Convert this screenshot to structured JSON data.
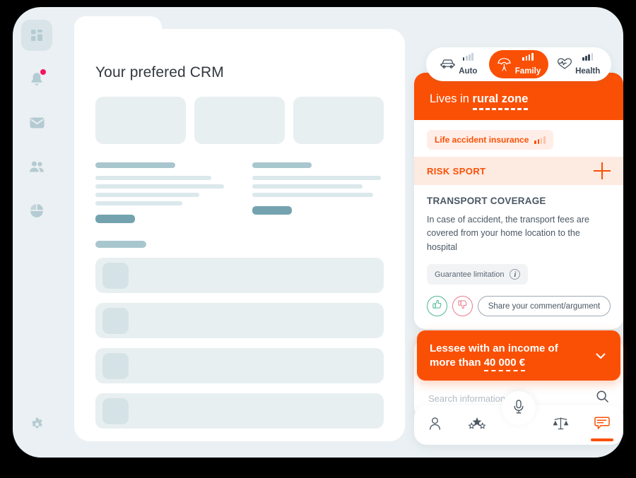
{
  "sidebar": {
    "items": [
      {
        "name": "dashboard",
        "icon": "grid-icon",
        "active": true,
        "badge": false
      },
      {
        "name": "notifications",
        "icon": "bell-icon",
        "active": false,
        "badge": true
      },
      {
        "name": "messages",
        "icon": "envelope-icon",
        "active": false,
        "badge": false
      },
      {
        "name": "contacts",
        "icon": "people-icon",
        "active": false,
        "badge": false
      },
      {
        "name": "analytics",
        "icon": "pie-chart-icon",
        "active": false,
        "badge": false
      }
    ],
    "bottom_item": {
      "name": "settings",
      "icon": "gear-icon"
    }
  },
  "crm": {
    "title": "Your prefered CRM",
    "tiles": [
      1,
      2,
      3
    ],
    "skeleton_columns": [
      {
        "head_width": "61%",
        "lines": [
          "88%",
          "98%",
          "79%",
          "66%"
        ],
        "chip": "small-dark"
      },
      {
        "head_width": "45%",
        "lines": [
          "98%",
          "84%",
          "92%"
        ],
        "chip": "small-dark"
      }
    ],
    "list_rows": [
      1,
      2,
      3,
      4
    ]
  },
  "tabs": [
    {
      "label": "Auto",
      "icon": "car-icon",
      "selected": false,
      "signal_level": 1
    },
    {
      "label": "Family",
      "icon": "umbrella-family-icon",
      "selected": true,
      "signal_level": 4
    },
    {
      "label": "Health",
      "icon": "heart-pulse-icon",
      "selected": false,
      "selected_alt": false,
      "signal_level": 3
    }
  ],
  "banner": {
    "prefix": "Lives in ",
    "highlight": "rural zone"
  },
  "insurance_chip": {
    "label": "Life accident insurance",
    "signal_level": 2
  },
  "risk_section": {
    "label": "RISK SPORT",
    "expand_icon": "plus-icon"
  },
  "coverage": {
    "title": "TRANSPORT COVERAGE",
    "description": "In case of accident, the transport fees are covered from your home location to the hospital",
    "guarantee_chip": {
      "label": "Guarantee limitation",
      "icon": "info-icon",
      "icon_glyph": "i"
    },
    "feedback": {
      "thumbs_up": "thumbs-up-icon",
      "thumbs_down": "thumbs-down-icon",
      "comment_label": "Share your comment/argument"
    }
  },
  "lessee": {
    "line1": "Lessee with an income of",
    "line2_prefix": "more than ",
    "amount": "40 000 €",
    "chevron": "chevron-down-icon"
  },
  "search": {
    "placeholder": "Search information...",
    "value": "",
    "icon": "search-icon"
  },
  "bottom_nav": {
    "items": [
      {
        "name": "profile",
        "icon": "person-icon",
        "active": false
      },
      {
        "name": "favorites",
        "icon": "stars-icon",
        "active": false
      },
      {
        "name": "mic",
        "icon": "microphone-icon",
        "active": false
      },
      {
        "name": "compare",
        "icon": "scales-icon",
        "active": false
      },
      {
        "name": "chat",
        "icon": "chat-bubble-icon",
        "active": true
      }
    ]
  },
  "colors": {
    "accent_orange": "#fa5005",
    "accent_orange_soft": "#fdeae1",
    "accent_orange_chip": "#ffeee7",
    "panel_bg": "#eaf0f3",
    "skeleton_light": "#dbe8ec",
    "skeleton_mid": "#a8c6cd",
    "skeleton_dark": "#74a3af",
    "tile_bg": "#e8eff1",
    "text_dark": "#33383e",
    "text_muted": "#4a5763",
    "thumbs_up_green": "#4db793",
    "thumbs_down_pink": "#ea7c8e",
    "notif_dot": "#f5145e"
  }
}
